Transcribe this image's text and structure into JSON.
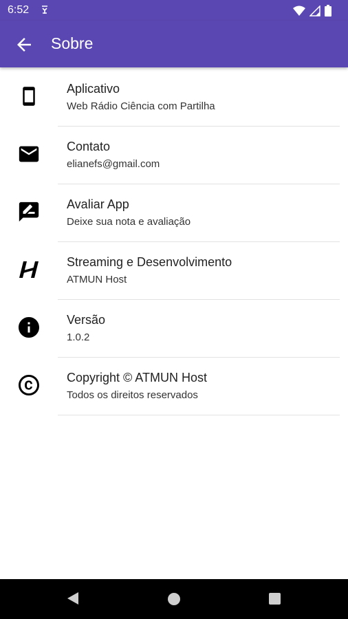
{
  "status_bar": {
    "time": "6:52",
    "icons": [
      "notification-icon",
      "wifi-icon",
      "signal-icon",
      "battery-icon"
    ]
  },
  "app_bar": {
    "title": "Sobre",
    "back_icon": "arrow-back-icon",
    "color": "#5b47b1"
  },
  "items": [
    {
      "icon": "smartphone-icon",
      "title": "Aplicativo",
      "subtitle": "Web Rádio Ciência com Partilha"
    },
    {
      "icon": "email-icon",
      "title": "Contato",
      "subtitle": "elianefs@gmail.com"
    },
    {
      "icon": "rate-review-icon",
      "title": "Avaliar App",
      "subtitle": "Deixe sua nota e avaliação"
    },
    {
      "icon": "host-logo-icon",
      "title": "Streaming e Desenvolvimento",
      "subtitle": "ATMUN Host"
    },
    {
      "icon": "info-icon",
      "title": "Versão",
      "subtitle": "1.0.2"
    },
    {
      "icon": "copyright-icon",
      "title": "Copyright © ATMUN Host",
      "subtitle": "Todos os direitos reservados"
    }
  ],
  "nav_bar": {
    "icons": [
      "nav-back-icon",
      "nav-home-icon",
      "nav-recents-icon"
    ]
  }
}
